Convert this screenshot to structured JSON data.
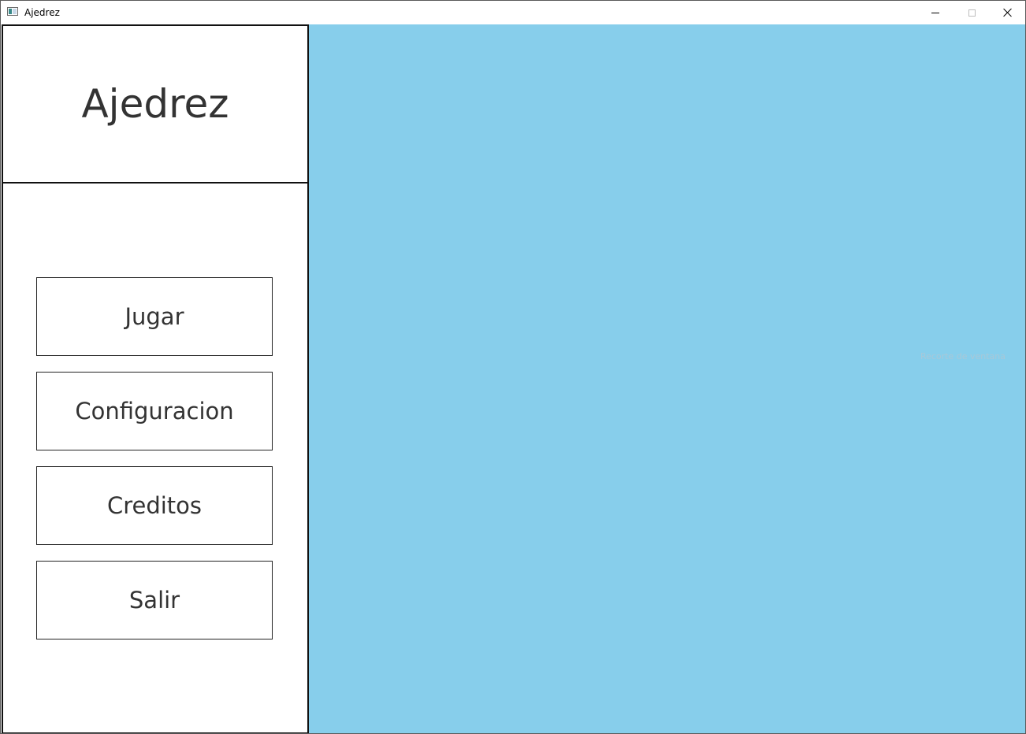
{
  "window": {
    "title": "Ajedrez"
  },
  "sidebar": {
    "app_title": "Ajedrez",
    "buttons": [
      {
        "label": "Jugar"
      },
      {
        "label": "Configuracion"
      },
      {
        "label": "Creditos"
      },
      {
        "label": "Salir"
      }
    ]
  },
  "content": {
    "background_color": "#87ceeb",
    "overlay_text": "Recorte de ventana"
  },
  "icons": {
    "app": "app-window-icon",
    "minimize": "minimize-icon",
    "maximize": "maximize-icon",
    "close": "close-icon"
  }
}
